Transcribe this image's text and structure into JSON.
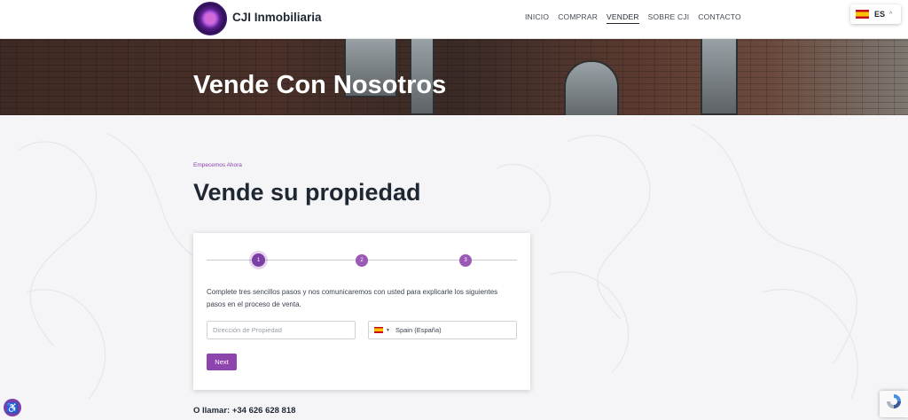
{
  "header": {
    "brand": "CJI Inmobiliaria",
    "nav": [
      "INICIO",
      "COMPRAR",
      "VENDER",
      "SOBRE CJI",
      "CONTACTO"
    ],
    "active_nav": "VENDER",
    "language": {
      "code": "ES",
      "flag": "spain-flag-icon"
    }
  },
  "hero": {
    "title": "Vende Con Nosotros"
  },
  "section": {
    "eyebrow": "Empecemos Ahora",
    "heading": "Vende su propiedad"
  },
  "form": {
    "steps": [
      "1",
      "2",
      "3"
    ],
    "active_step": 1,
    "description": "Complete tres sencillos pasos y nos comunicaremos con usted para explicarle los siguientes pasos en el proceso de venta.",
    "address_placeholder": "Dirección de Propiedad",
    "country_value": "Spain (España)",
    "next_label": "Next"
  },
  "contact": {
    "call_text": "O llamar: +34 626 628 818"
  },
  "colors": {
    "accent": "#8e44ad",
    "heading": "#1f2733"
  }
}
